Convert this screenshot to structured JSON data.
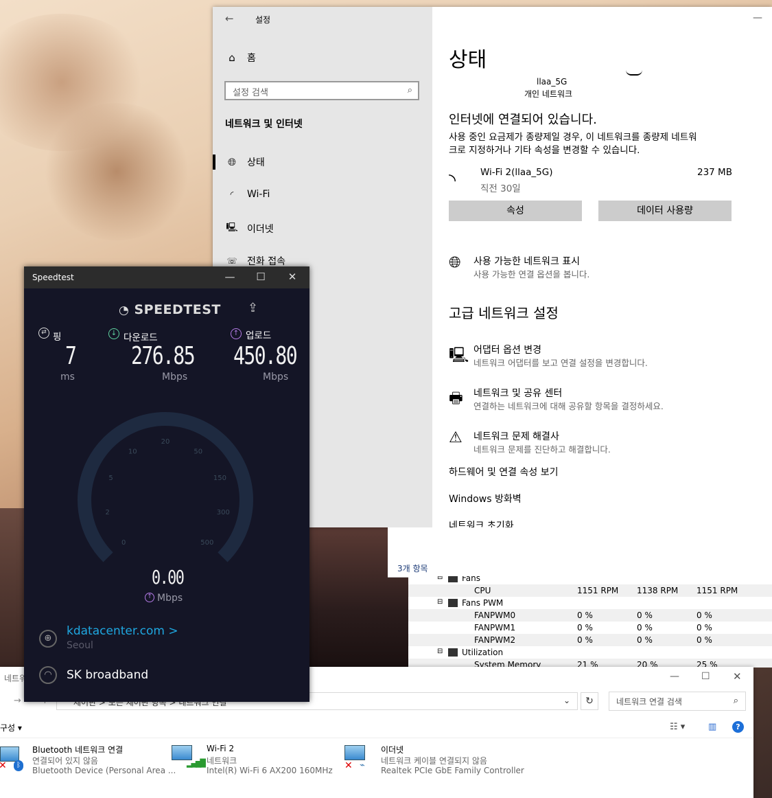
{
  "settings": {
    "window_title": "설정",
    "nav_home": "홈",
    "search_placeholder": "설정 검색",
    "section_title": "네트워크 및 인터넷",
    "nav_items": [
      {
        "label": "상태"
      },
      {
        "label": "Wi-Fi"
      },
      {
        "label": "이더넷"
      },
      {
        "label": "전화 접속"
      }
    ],
    "page_title": "상태",
    "network_name": "llaa_5G",
    "network_type": "개인 네트워크",
    "connected_heading": "인터넷에 연결되어 있습니다.",
    "connected_desc_line1": "사용 중인 요금제가 종량제일 경우, 이 네트워크를 종량제 네트워",
    "connected_desc_line2": "크로 지정하거나 기타 속성을 변경할 수 있습니다.",
    "adapter_name": "Wi-Fi 2(llaa_5G)",
    "adapter_period": "직전 30일",
    "adapter_usage": "237 MB",
    "properties_button": "속성",
    "data_usage_button": "데이터 사용량",
    "show_networks_title": "사용 가능한 네트워크 표시",
    "show_networks_sub": "사용 가능한 연결 옵션을 봅니다.",
    "advanced_heading": "고급 네트워크 설정",
    "adapter_options_title": "어댑터 옵션 변경",
    "adapter_options_sub": "네트워크 어댑터를 보고 연결 설정을 변경합니다.",
    "sharing_center_title": "네트워크 및 공유 센터",
    "sharing_center_sub": "연결하는 네트워크에 대해 공유할 항목을 결정하세요.",
    "troubleshooter_title": "네트워크 문제 해결사",
    "troubleshooter_sub": "네트워크 문제를 진단하고 해결합니다.",
    "hardware_link": "하드웨어 및 연결 속성 보기",
    "firewall_link": "Windows 방화벽",
    "reset_link": "네트워크 초기화"
  },
  "speedtest": {
    "window_title": "Speedtest",
    "logo": "SPEEDTEST",
    "ping_label": "핑",
    "ping_value": "7",
    "ping_unit": "ms",
    "download_label": "다운로드",
    "download_value": "276.85",
    "download_unit": "Mbps",
    "upload_label": "업로드",
    "upload_value": "450.80",
    "upload_unit": "Mbps",
    "gauge_value": "0.00",
    "gauge_unit": "Mbps",
    "gauge_ticks": [
      "0",
      "2",
      "5",
      "10",
      "20",
      "50",
      "150",
      "300",
      "500"
    ],
    "server_name": "kdatacenter.com",
    "server_chevron": ">",
    "server_city": "Seoul",
    "isp": "SK broadband",
    "colors": {
      "background": "#141526",
      "accent": "#1fa7e0",
      "download": "#5fd3a0",
      "upload": "#b47be6"
    }
  },
  "behind_panel": {
    "item_count": "3개 항목"
  },
  "hwmonitor": {
    "rows": [
      {
        "name": "Fans",
        "v1": "",
        "v2": "",
        "v3": "",
        "level": 1,
        "group": true
      },
      {
        "name": "CPU",
        "v1": "1151 RPM",
        "v2": "1138 RPM",
        "v3": "1151 RPM",
        "level": 2
      },
      {
        "name": "Fans PWM",
        "v1": "",
        "v2": "",
        "v3": "",
        "level": 1,
        "group": true
      },
      {
        "name": "FANPWM0",
        "v1": "0 %",
        "v2": "0 %",
        "v3": "0 %",
        "level": 2
      },
      {
        "name": "FANPWM1",
        "v1": "0 %",
        "v2": "0 %",
        "v3": "0 %",
        "level": 2
      },
      {
        "name": "FANPWM2",
        "v1": "0 %",
        "v2": "0 %",
        "v3": "0 %",
        "level": 2
      },
      {
        "name": "Utilization",
        "v1": "",
        "v2": "",
        "v3": "",
        "level": 1,
        "group": true
      },
      {
        "name": "System Memory",
        "v1": "21 %",
        "v2": "20 %",
        "v3": "25 %",
        "level": 2
      }
    ]
  },
  "explorer": {
    "title_fragment": "네트워",
    "breadcrumb": "제어판 > 모든 제어판 항목 > 네트워크 연결",
    "search_placeholder": "네트워크 연결 검색",
    "organize_label": "구성",
    "items": [
      {
        "name": "Bluetooth 네트워크 연결",
        "status": "연결되어 있지 않음",
        "device": "Bluetooth Device (Personal Area ..."
      },
      {
        "name": "Wi-Fi 2",
        "status": "네트워크",
        "device": "Intel(R) Wi-Fi 6 AX200 160MHz"
      },
      {
        "name": "이더넷",
        "status": "네트워크 케이블 연결되지 않음",
        "device": "Realtek PCIe GbE Family Controller"
      }
    ]
  }
}
